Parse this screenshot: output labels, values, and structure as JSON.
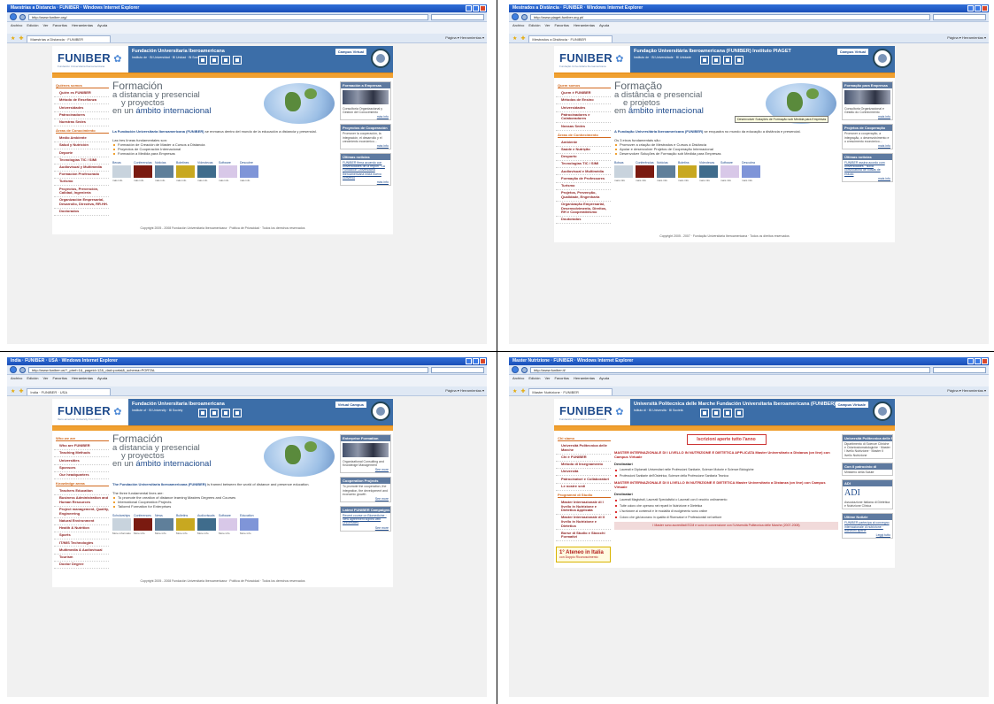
{
  "windows": [
    {
      "window_title": "Maestrías a Distancia · FUNIBER · Windows Internet Explorer",
      "url": "http://www.funiber.org/",
      "tab_label": "Maestrías a Distancia · FUNIBER",
      "menu": [
        "Archivo",
        "Edición",
        "Ver",
        "Favoritos",
        "Herramientas",
        "Ayuda"
      ],
      "tab_tools": "Página ▾  Herramientas ▾",
      "logo": "FUNIBER",
      "logo_sub": "Fundación Universitaria Iberoamericana",
      "header_title": "Fundación Universitaria Iberoamericana",
      "header_sub": "Instituto de  ·  Bl Universidad  ·  Bl Unidad  ·  Bl Socie dad",
      "header_button": "Campus Virtual",
      "nav_sections": [
        {
          "heading": "Quiénes somos",
          "items": [
            "Quién es FUNIBER",
            "Método de Enseñanza",
            "Universidades",
            "Patrocinadores",
            "Nuestras Sedes"
          ]
        },
        {
          "heading": "Áreas de Conocimiento",
          "items": [
            "Medio Ambiente",
            "Salud y Nutrición",
            "Deporte",
            "Tecnologías TIC / SIMI",
            "Audiovisual y Multimedia",
            "Formación Profesorado",
            "Turismo",
            "Proyectos, Prevención, Calidad, Ingeniería",
            "Organización Empresarial, Desarrollo, Directiva, RR.HH.",
            "Doctorados"
          ]
        }
      ],
      "hero": {
        "l1": "Formación",
        "l2": "a distancia y presencial",
        "l3": "y proyectos",
        "l4a": "en un ",
        "l4b": "ámbito internacional"
      },
      "intro_bold": "La Fundación Universitaria Iberoamericana (FUNIBER)",
      "intro": " se enmarca dentro del mundo de la educación a distancia y presencial.",
      "lines_heading": "Las tres líneas fundamentales son:",
      "bullets": [
        "Formación de Creación de Master a Cursos a Distancia",
        "Proyectos de Cooperación Internacional",
        "Formación a Medida para Empresas"
      ],
      "thumbs": [
        {
          "label": "Becas",
          "caption": "más info",
          "color": "#c8d3dd"
        },
        {
          "label": "Conferencias",
          "caption": "más info",
          "color": "#7a1a10"
        },
        {
          "label": "Noticias",
          "caption": "más info",
          "color": "#5f7f9a"
        },
        {
          "label": "Boletines",
          "caption": "más info",
          "color": "#c8a820"
        },
        {
          "label": "Vídeotecas",
          "caption": "más info",
          "color": "#3f6c8c"
        },
        {
          "label": "Software",
          "caption": "más info",
          "color": "#d8c8e8"
        },
        {
          "label": "Descubre",
          "caption": "más info",
          "color": "#7f95d8"
        }
      ],
      "boxes": [
        {
          "title": "Formación a Empresas",
          "text": "Consultoría Organizacional y Gestión del Conocimiento",
          "more": "más info",
          "image": true,
          "link": false
        },
        {
          "title": "Proyectos de Cooperación",
          "text": "Promover la cooperación, la integración, el desarrollo y el crecimiento económico...",
          "more": "más info",
          "image": false,
          "link": false
        },
        {
          "title": "Últimas noticias",
          "text": "FUNIBER firma acuerdo con universidades de la región · La Fundación Universitaria Iberoamericana inicia nuevo convenio",
          "more": "más info",
          "image": false,
          "link": true
        }
      ],
      "footer": "Copyright 2005 - 2008 Fundación Universitaria Iberoamericana · Política de Privacidad · Todos los derechos reservados",
      "tooltip": ""
    },
    {
      "window_title": "Mestrados a Distância · FUNIBER · Windows Internet Explorer",
      "url": "http://www.piaget-funiber.org.pt/",
      "tab_label": "Mestrados a Distância · FUNIBER",
      "menu": [
        "Archivo",
        "Edición",
        "Ver",
        "Favoritos",
        "Herramientas",
        "Ayuda"
      ],
      "tab_tools": "Página ▾  Herramientas ▾",
      "logo": "FUNIBER",
      "logo_sub": "Fundação Universitária Iberoamericana",
      "header_title": "Fundação Universitária Iberoamericana (FUNIBER) Instituto PIAGET",
      "header_sub": "Instituto de  ·  Bl Universidade  ·  Bl Unidade",
      "header_button": "Campus Virtual",
      "nav_sections": [
        {
          "heading": "Quem somos",
          "items": [
            "Quem é FUNIBER",
            "Métodos de Ensino",
            "Universidades",
            "Patrocinadores e Colaboradores",
            "Nossas Sedes"
          ]
        },
        {
          "heading": "Áreas de Conhecimento",
          "items": [
            "Ambiente",
            "Saúde e Nutrição",
            "Desporto",
            "Tecnologias TIC / SIMI",
            "Audiovisual e Multimédia",
            "Formação de Professores",
            "Turismo",
            "Projetos, Prevenção, Qualidade, Engenharia",
            "Organização Empresarial, Desenvolvimento, Direitos, RH e Cooperativismo",
            "Doutorados"
          ]
        }
      ],
      "hero": {
        "l1": "Formação",
        "l2": "a distância e presencial",
        "l3": "e projetos",
        "l4a": "em ",
        "l4b": "âmbito internacional"
      },
      "intro_bold": "A Fundação Universitária Iberoamericana (FUNIBER)",
      "intro": " se enquadra no mundo da educação a distância e presencial.",
      "lines_heading": "Os 3 eixos fundamentais são:",
      "bullets": [
        "Promover a criação de Mestrados e Cursos à Distância",
        "Apoiar e desenvolver Projetos de Cooperação Internacional",
        "Desenvolver Soluções de Formação sob Medida para Empresas"
      ],
      "thumbs": [
        {
          "label": "Bolsas",
          "caption": "mais info",
          "color": "#c8d3dd"
        },
        {
          "label": "Conferências",
          "caption": "mais info",
          "color": "#7a1a10"
        },
        {
          "label": "Notícias",
          "caption": "mais info",
          "color": "#5f7f9a"
        },
        {
          "label": "Boletins",
          "caption": "mais info",
          "color": "#c8a820"
        },
        {
          "label": "Videotecas",
          "caption": "mais info",
          "color": "#3f6c8c"
        },
        {
          "label": "Software",
          "caption": "mais info",
          "color": "#d8c8e8"
        },
        {
          "label": "Descubra",
          "caption": "mais info",
          "color": "#7f95d8"
        }
      ],
      "boxes": [
        {
          "title": "Formação para Empresas",
          "text": "Consultoria Organizacional e Gestão do Conhecimento",
          "more": "mais info",
          "image": true,
          "link": false
        },
        {
          "title": "Projetos de Cooperação",
          "text": "Promover a cooperação, a integração, o desenvolvimento e o crescimento económico...",
          "more": "mais info",
          "image": false,
          "link": false
        },
        {
          "title": "Últimas notícias",
          "text": "FUNIBER assina acordo com universidades · Nova convocatória de bolsas de estudo",
          "more": "mais info",
          "image": false,
          "link": true
        }
      ],
      "footer": "Copyright 2005 - 2007 · Fundação Universitária Iberoamericana · Todos os direitos reservados",
      "tooltip": "Desenvolver Soluções de Formação sob Medida para Empresas"
    },
    {
      "window_title": "India · FUNIBER · USA · Windows Internet Explorer",
      "url": "http://www.funiber.us/?_piref=1&_pageid=12&_dad=portal&_schema=PORTAL",
      "tab_label": "India · FUNIBER · USA",
      "menu": [
        "Archivo",
        "Edición",
        "Ver",
        "Favoritos",
        "Herramientas",
        "Ayuda"
      ],
      "tab_tools": "Página ▾  Herramientas ▾",
      "logo": "FUNIBER",
      "logo_sub": "Ibero-american University Foundation",
      "header_title": "Fundación Universitaria Iberoamericana",
      "header_sub": "Institute of  ·  Bl University  ·  Bl Society",
      "header_button": "Virtual Campus",
      "nav_sections": [
        {
          "heading": "Who we are",
          "items": [
            "Who are FUNIBER",
            "Teaching Methods",
            "Universities",
            "Sponsors",
            "Our headquarters"
          ]
        },
        {
          "heading": "Knowledge areas",
          "items": [
            "Teachers Education",
            "Business Administration and Human Resources",
            "Project management, Quality, Engineering",
            "Natural Environment",
            "Health & Nutrition",
            "Sports",
            "IT/MIS Technologies",
            "Multimedia & Audiovisual",
            "Tourism",
            "Doctor Degree"
          ]
        }
      ],
      "hero": {
        "l1": "Formación",
        "l2": "a distancia y presencial",
        "l3": "y proyectos",
        "l4a": "en un ",
        "l4b": "ámbito internacional"
      },
      "intro_bold": "The Fundación Universitaria Iberoamericana (FUNIBER)",
      "intro": " is framed between the world of distance and presence education.",
      "lines_heading": "The three fundamental lines are:",
      "bullets": [
        "To promote the creation of distance learning Masters Degrees and Courses",
        "International Cooperation Projects",
        "Tailored Formation for Enterprises"
      ],
      "thumbs": [
        {
          "label": "Scholarships",
          "caption": "More information",
          "color": "#c8d3dd"
        },
        {
          "label": "Conferences",
          "caption": "More info",
          "color": "#7a1a10"
        },
        {
          "label": "News",
          "caption": "More info",
          "color": "#5f7f9a"
        },
        {
          "label": "Bulletins",
          "caption": "More info",
          "color": "#c8a820"
        },
        {
          "label": "Audiovisuals",
          "caption": "More info",
          "color": "#3f6c8c"
        },
        {
          "label": "Software",
          "caption": "More info",
          "color": "#d8c8e8"
        },
        {
          "label": "Education",
          "caption": "More info",
          "color": "#7f95d8"
        }
      ],
      "boxes": [
        {
          "title": "Enterprise Formation",
          "text": "Organizational Consulting and Knowledge Management",
          "more": "See more",
          "image": true,
          "link": false
        },
        {
          "title": "Cooperation Projects",
          "text": "To promote the cooperation, the integration, the development and economic growth",
          "more": "See more",
          "image": false,
          "link": false
        },
        {
          "title": "Latest FUNIBER Campaigns",
          "text": "Recent course on Biomedicine · New agreement signed with Universities",
          "more": "See more",
          "image": false,
          "link": true
        }
      ],
      "footer": "Copyright 2005 - 2008 Fundación Universitaria Iberoamericana · Política de Privacidad · Todos los derechos reservados",
      "tooltip": ""
    },
    {
      "window_title": "Master Nutrizione · FUNIBER · Windows Internet Explorer",
      "url": "http://www.funiber.it/",
      "tab_label": "Master Nutrizione · FUNIBER",
      "menu": [
        "Archivo",
        "Edición",
        "Ver",
        "Favoritos",
        "Herramientas",
        "Ayuda"
      ],
      "tab_tools": "Página ▾  Herramientas ▾",
      "logo": "FUNIBER",
      "logo_sub": "Fundación Universitaria Iberoamericana",
      "header_title": "Università Politecnica delle Marche  Fundación Universitaria Iberoamericana (FUNIBER)",
      "header_sub": "Istituto di  ·  Bl Università  ·  Bl Società",
      "header_button": "Campus Virtuale",
      "nav_sections": [
        {
          "heading": "Chi siamo",
          "items": [
            "Università Politecnica delle Marche",
            "Chi è FUNIBER",
            "Metodo di Insegnamento",
            "Università",
            "Patrocinatori e Collaboratori",
            "Le nostre sedi"
          ]
        },
        {
          "heading": "Programmi di Studio",
          "items": [
            "Master Internazionale di I livello in Nutrizione e Dietetica Applicata",
            "Master Internazionale di II livello in Nutrizione e Dietetica",
            "Borse di Studio e Sbocchi Formativi"
          ]
        }
      ],
      "banner": "Iscrizioni aperte tutto l'anno",
      "it_blocks": [
        {
          "title": "MASTER INTERNAZIONALE DI I LIVELLO IN NUTRIZIONE E DIETETICA APPLICATA  Master Universitario a Distanza (on line) con Campus Virtuale",
          "sub": "Destinatari",
          "items": [
            "Laureati e Diplomati Universitari nelle Professioni Sanitarie, Scienze Motorie e Scienze Biologiche",
            "Professioni Sanitarie dell'Ostetrica, Scienze della Professione Sanitaria Tecnica"
          ]
        },
        {
          "title": "MASTER INTERNAZIONALE DI II LIVELLO IN NUTRIZIONE E DIETETICA  Master Universitario a Distanza (on line) con Campus Virtuale",
          "sub": "Destinatari",
          "items": [
            "Laureati Magistrali, Laureati Specialistici o Laureati con il vecchio ordinamento",
            "Tutte coloro che operano nei reparti in Nutrizione e Dietetica",
            "L'iscrizione ai contenuti e le modalità di svolgimento sono online",
            "Coloro che già lavorano in qualità di Ricercatori e Professionisti nel settore"
          ]
        }
      ],
      "it_note": "I Master sono accreditati ECM e sono in convenzione con l'Università Politecnica delle Marche (2007-2008)",
      "promo_title": "1° Ateneo in Italia",
      "promo_sub": "con Doppio Riconoscimento",
      "boxes": [
        {
          "title": "Università Politecnica delle Marche",
          "text": "Dipartimento di Scienze Cliniche e Odontostomatologiche · Master I livello Nutrizione · Master II livello Nutrizione",
          "more": "",
          "image": false,
          "link": false
        },
        {
          "title": "Con il patrocinio di",
          "text": "Ministero della Salute",
          "more": "",
          "image": false,
          "link": false
        },
        {
          "title": "ADI",
          "text": "Associazione Italiana di Dietetica e Nutrizione Clinica",
          "more": "",
          "image": false,
          "link": false
        },
        {
          "title": "Ultime Notizie",
          "text": "FUNIBER partecipa al convegno internazionale di nutrizione · Iscrizioni aperte",
          "more": "Leggi tutto",
          "image": false,
          "link": true
        }
      ],
      "footer": "",
      "tooltip": ""
    }
  ]
}
